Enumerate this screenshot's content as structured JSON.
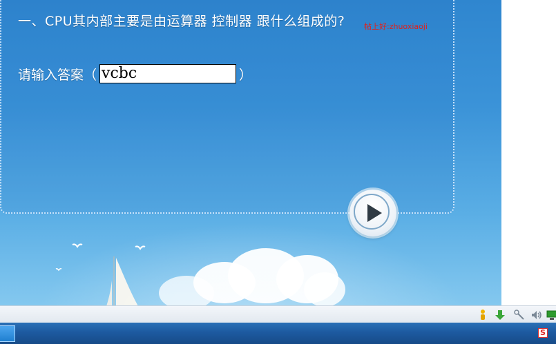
{
  "question": {
    "text": "一、CPU其内部主要是由运算器 控制器 跟什么组成的?",
    "watermark": "帖上好:zhuoxiaoji"
  },
  "answer": {
    "label": "请输入答案（",
    "value": "vcbc",
    "close": "）"
  },
  "play_button": {
    "icon": "play-icon"
  },
  "statusbar": {
    "icons": [
      "person-icon",
      "download-arrow-icon",
      "network-icon",
      "volume-icon",
      "display-icon"
    ]
  },
  "taskbar": {
    "start_label": "",
    "tray_app_label": "S"
  },
  "colors": {
    "sky": "#3b93d8",
    "watermark": "#e0211b",
    "taskbar": "#1d5aa0"
  }
}
